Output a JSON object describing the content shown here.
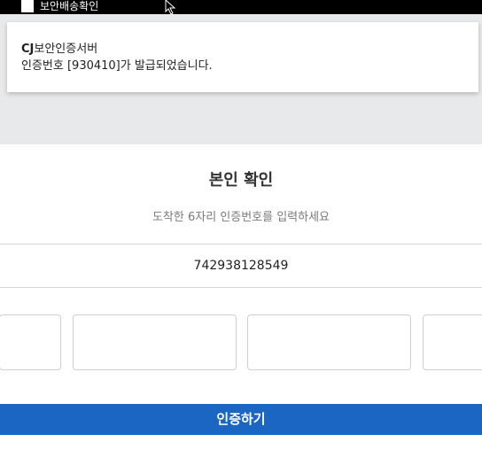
{
  "statusbar": {
    "app_name": "보안배송확인"
  },
  "notification": {
    "sender_bold": "CJ",
    "sender_rest": "보안인증서버",
    "message": "인증번호 [930410]가 발급되었습니다."
  },
  "verify": {
    "title": "본인 확인",
    "subtitle": "도착한 6자리 인증번호를 입력하세요",
    "tracking_number": "742938128549",
    "submit_label": "인증하기"
  },
  "colors": {
    "accent": "#1a66c2",
    "backdrop": "#e8e9ea"
  },
  "icons": {
    "cursor": "mouse-pointer-icon",
    "app": "app-square-icon"
  }
}
